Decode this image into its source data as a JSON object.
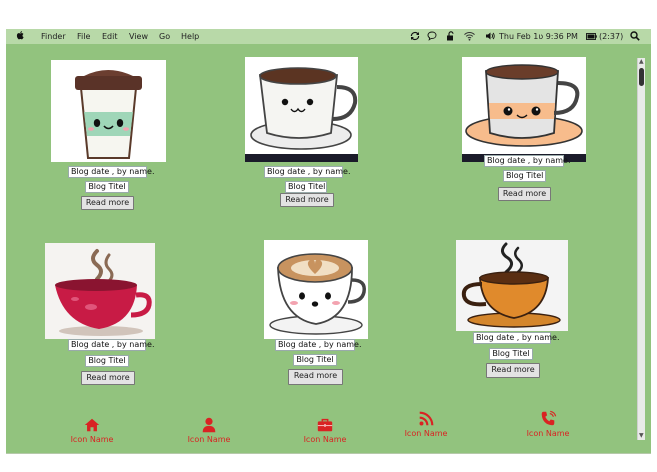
{
  "menubar": {
    "apple_icon": "apple-icon",
    "items": [
      "Finder",
      "File",
      "Edit",
      "View",
      "Go",
      "Help"
    ],
    "status_icons": [
      "sync-icon",
      "chat-bubble-icon",
      "lock-icon",
      "wifi-icon",
      "volume-icon"
    ],
    "clock": "Thu Feb 1ʋ 9:36 PM",
    "battery": "(2:37)",
    "search_icon": "search-icon"
  },
  "posts": [
    {
      "image": "coffee-cup-kawaii-image",
      "meta": "Blog date , by name.",
      "title": "Blog Titel",
      "button": "Read more"
    },
    {
      "image": "coffee-mug-kawaii-image",
      "meta": "Blog date , by name.",
      "title": "Blog Titel",
      "button": "Read more"
    },
    {
      "image": "coffee-mug-saucer-image",
      "meta": "Blog date , by name.",
      "title": "Blog Titel",
      "button": "Read more"
    },
    {
      "image": "red-coffee-cup-image",
      "meta": "Blog date , by name.",
      "title": "Blog Titel",
      "button": "Read more"
    },
    {
      "image": "latte-cup-kawaii-image",
      "meta": "Blog date , by name.",
      "title": "Blog Titel",
      "button": "Read more"
    },
    {
      "image": "orange-coffee-cup-image",
      "meta": "Blog date , by name.",
      "title": "Blog Titel",
      "button": "Read more"
    }
  ],
  "nav": [
    {
      "icon": "home-icon",
      "label": "Icon Name"
    },
    {
      "icon": "user-icon",
      "label": "Icon Name"
    },
    {
      "icon": "briefcase-icon",
      "label": "Icon Name"
    },
    {
      "icon": "rss-icon",
      "label": "Icon Name"
    },
    {
      "icon": "phone-icon",
      "label": "Icon Name"
    }
  ],
  "colors": {
    "menubar": "#b8d9a8",
    "background": "#92c37e",
    "nav_icon": "#d92323"
  }
}
